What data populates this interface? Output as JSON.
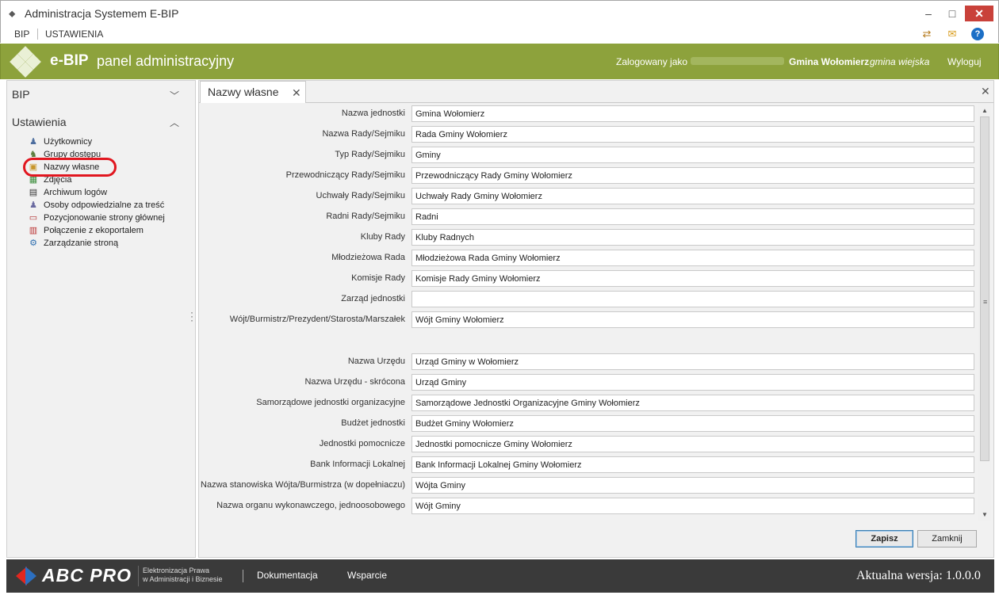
{
  "window": {
    "title": "Administracja Systemem E-BIP",
    "minimize": "–",
    "maximize": "□",
    "close": "✕"
  },
  "menubar": {
    "items": [
      "BIP",
      "USTAWIENIA"
    ],
    "icons": [
      "refresh-icon",
      "mail-icon",
      "help-icon"
    ]
  },
  "header": {
    "brand": "e-BIP",
    "subtitle": "panel administracyjny",
    "logged_label": "Zalogowany jako",
    "organization": "Gmina Wołomierz",
    "org_type": "gmina wiejska",
    "logout": "Wyloguj"
  },
  "sidebar": {
    "sections": [
      {
        "label": "BIP",
        "expanded": false
      },
      {
        "label": "Ustawienia",
        "expanded": true
      }
    ],
    "items": [
      {
        "label": "Użytkownicy",
        "icon": "users-icon"
      },
      {
        "label": "Grupy dostępu",
        "icon": "groups-icon"
      },
      {
        "label": "Nazwy własne",
        "icon": "names-icon",
        "selected": true
      },
      {
        "label": "Zdjęcia",
        "icon": "photo-icon"
      },
      {
        "label": "Archiwum logów",
        "icon": "log-archive-icon"
      },
      {
        "label": "Osoby odpowiedzialne za treść",
        "icon": "responsible-persons-icon"
      },
      {
        "label": "Pozycjonowanie strony głównej",
        "icon": "positioning-icon"
      },
      {
        "label": "Połączenie z ekoportalem",
        "icon": "ekoportal-icon"
      },
      {
        "label": "Zarządzanie stroną",
        "icon": "site-management-icon"
      }
    ]
  },
  "tab": {
    "label": "Nazwy własne",
    "close": "✕"
  },
  "form": {
    "fields": [
      {
        "label": "Nazwa jednostki",
        "value": "Gmina Wołomierz"
      },
      {
        "label": "Nazwa Rady/Sejmiku",
        "value": "Rada Gminy Wołomierz"
      },
      {
        "label": "Typ Rady/Sejmiku",
        "value": "Gminy"
      },
      {
        "label": "Przewodniczący Rady/Sejmiku",
        "value": "Przewodniczący Rady Gminy Wołomierz"
      },
      {
        "label": "Uchwały Rady/Sejmiku",
        "value": "Uchwały Rady Gminy Wołomierz"
      },
      {
        "label": "Radni Rady/Sejmiku",
        "value": "Radni"
      },
      {
        "label": "Kluby Rady",
        "value": "Kluby Radnych"
      },
      {
        "label": "Młodzieżowa Rada",
        "value": "Młodzieżowa Rada Gminy Wołomierz"
      },
      {
        "label": "Komisje Rady",
        "value": "Komisje Rady Gminy Wołomierz"
      },
      {
        "label": "Zarząd jednostki",
        "value": ""
      },
      {
        "label": "Wójt/Burmistrz/Prezydent/Starosta/Marszałek",
        "value": "Wójt Gminy Wołomierz"
      },
      {
        "label": "Nazwa Urzędu",
        "value": "Urząd Gminy w Wołomierz"
      },
      {
        "label": "Nazwa Urzędu - skrócona",
        "value": "Urząd Gminy"
      },
      {
        "label": "Samorządowe jednostki organizacyjne",
        "value": "Samorządowe Jednostki Organizacyjne Gminy Wołomierz"
      },
      {
        "label": "Budżet jednostki",
        "value": "Budżet Gminy Wołomierz"
      },
      {
        "label": "Jednostki pomocnicze",
        "value": "Jednostki pomocnicze Gminy Wołomierz"
      },
      {
        "label": "Bank Informacji Lokalnej",
        "value": "Bank Informacji Lokalnej Gminy Wołomierz"
      },
      {
        "label": "Nazwa stanowiska Wójta/Burmistrza (w dopełniaczu)",
        "value": "Wójta Gminy"
      },
      {
        "label": "Nazwa organu wykonawczego, jednoosobowego",
        "value": "Wójt Gminy"
      }
    ],
    "save": "Zapisz",
    "cancel": "Zamknij"
  },
  "footer": {
    "brand": "ABC PRO",
    "tagline_1": "Elektronizacja Prawa",
    "tagline_2": "w Administracji i Biznesie",
    "links": [
      "Dokumentacja",
      "Wsparcie"
    ],
    "version": "Aktualna wersja: 1.0.0.0"
  },
  "colors": {
    "header_green": "#8da23c",
    "footer_dark": "#3a3a3a",
    "close_red": "#c9413a",
    "highlight_red": "#e1161f",
    "accent_blue": "#2c6fc0"
  }
}
